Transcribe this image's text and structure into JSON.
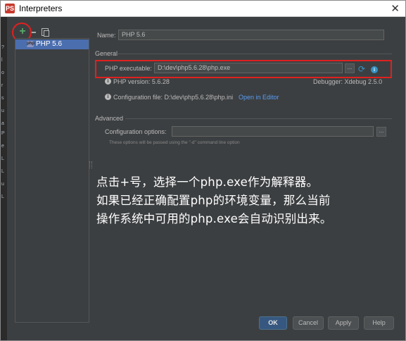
{
  "window": {
    "title": "Interpreters",
    "app_icon": "phpstorm-icon",
    "close_glyph": "✕"
  },
  "toolbar": {
    "add_glyph": "+",
    "remove_icon": "minus-icon",
    "copy_icon": "copy-icon"
  },
  "list": {
    "items": [
      {
        "label": "PHP 5.6",
        "icon": "php-icon",
        "selected": true
      }
    ]
  },
  "form": {
    "name_label": "Name:",
    "name_value": "PHP 5.6",
    "general_header": "General",
    "executable_label": "PHP executable:",
    "executable_value": "D:\\dev\\php5.6.28\\php.exe",
    "browse_glyph": "...",
    "php_version": "PHP version: 5.6.28",
    "debugger": "Debugger: Xdebug 2.5.0",
    "config_file": "Configuration file: D:\\dev\\php5.6.28\\php.ini",
    "open_in_editor": "Open in Editor",
    "advanced_header": "Advanced",
    "config_options_label": "Configuration options:",
    "config_options_value": "",
    "config_hint": "These options will be passed using the \"-d\" command line option"
  },
  "annotation": {
    "line1": "点击+号，选择一个php.exe作为解释器。",
    "line2": "如果已经正确配置php的环境变量，那么当前",
    "line3": "操作系统中可用的php.exe会自动识别出来。"
  },
  "buttons": {
    "ok": "OK",
    "cancel": "Cancel",
    "apply": "Apply",
    "help": "Help"
  },
  "background_strip": [
    "?",
    "l",
    "o",
    "r",
    "s",
    "u",
    "a",
    "P",
    "e",
    "L",
    "L",
    "u",
    "L"
  ],
  "colors": {
    "accent": "#4b6eaf",
    "highlight": "#e02020",
    "link": "#589df6"
  }
}
